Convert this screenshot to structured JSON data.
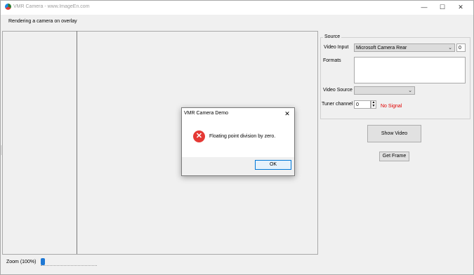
{
  "window": {
    "title": "VMR Camera - www.ImageEn.com",
    "controls": {
      "minimize": "—",
      "maximize": "☐",
      "close": "✕"
    }
  },
  "header": {
    "label": "Rendering a camera on overlay"
  },
  "source": {
    "group_title": "Source",
    "video_input": {
      "label": "Video Input",
      "value": "Microsoft Camera Rear",
      "index": "0"
    },
    "formats": {
      "label": "Formats",
      "value": ""
    },
    "video_source": {
      "label": "Video Source",
      "value": ""
    },
    "tuner_channel": {
      "label": "Tuner channel",
      "value": "0",
      "status": "No Signal"
    }
  },
  "buttons": {
    "show_video": "Show Video",
    "get_frame": "Get Frame"
  },
  "zoom": {
    "label": "Zoom (100%)",
    "level_fraction": 0.0
  },
  "dialog": {
    "title": "VMR Camera Demo",
    "message": "Floating point division by zero.",
    "ok_label": "OK",
    "close": "✕",
    "icon": "error-icon"
  },
  "colors": {
    "error_red": "#e53935",
    "status_red": "#e00000",
    "accent_blue": "#1e78d4"
  }
}
